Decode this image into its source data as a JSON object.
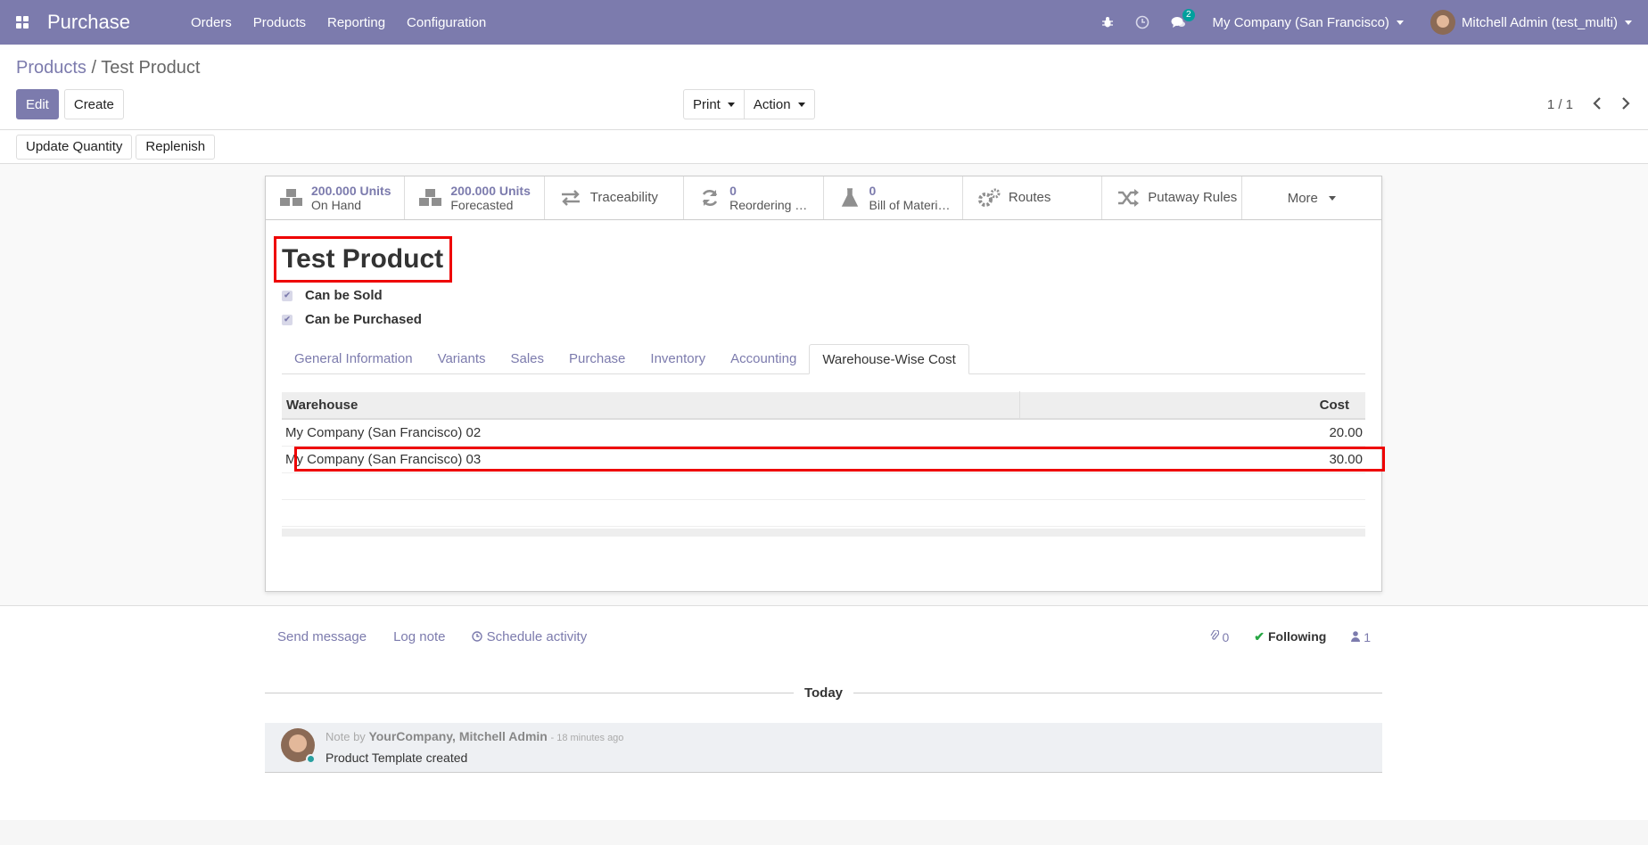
{
  "navbar": {
    "app_title": "Purchase",
    "menu": [
      "Orders",
      "Products",
      "Reporting",
      "Configuration"
    ],
    "chat_badge": "2",
    "company": "My Company (San Francisco)",
    "user": "Mitchell Admin (test_multi)"
  },
  "breadcrumb": {
    "parent": "Products",
    "separator": "/",
    "current": "Test Product"
  },
  "toolbar": {
    "edit_label": "Edit",
    "create_label": "Create",
    "print_label": "Print",
    "action_label": "Action",
    "pager": "1 / 1"
  },
  "statusbar": {
    "update_quantity": "Update Quantity",
    "replenish": "Replenish"
  },
  "smart_buttons": [
    {
      "value": "200.000 Units",
      "label": "On Hand",
      "icon": "cubes-icon"
    },
    {
      "value": "200.000 Units",
      "label": "Forecasted",
      "icon": "cubes-icon"
    },
    {
      "label": "Traceability",
      "icon": "exchange-icon"
    },
    {
      "value": "0",
      "label": "Reordering …",
      "icon": "refresh-icon"
    },
    {
      "value": "0",
      "label": "Bill of Materi…",
      "icon": "flask-icon"
    },
    {
      "label": "Routes",
      "icon": "cogs-icon"
    },
    {
      "label": "Putaway Rules",
      "icon": "random-icon"
    },
    {
      "label": "More",
      "icon": "caret-down-icon"
    }
  ],
  "product": {
    "name": "Test Product",
    "can_be_sold": "Can be Sold",
    "can_be_purchased": "Can be Purchased"
  },
  "tabs": [
    "General Information",
    "Variants",
    "Sales",
    "Purchase",
    "Inventory",
    "Accounting",
    "Warehouse-Wise Cost"
  ],
  "active_tab": "Warehouse-Wise Cost",
  "table": {
    "headers": [
      "Warehouse",
      "Cost"
    ],
    "rows": [
      [
        "My Company (San Francisco) 02",
        "20.00"
      ],
      [
        "My Company (San Francisco) 03",
        "30.00"
      ]
    ]
  },
  "chatter": {
    "send_message": "Send message",
    "log_note": "Log note",
    "schedule_activity": "Schedule activity",
    "attachments": "0",
    "following": "Following",
    "followers": "1",
    "today": "Today",
    "message": {
      "prefix": "Note by",
      "author": "YourCompany, Mitchell Admin",
      "time": "- 18 minutes ago",
      "body": "Product Template created"
    }
  },
  "colors": {
    "brand": "#7c7bad",
    "highlight": "#e00000"
  }
}
